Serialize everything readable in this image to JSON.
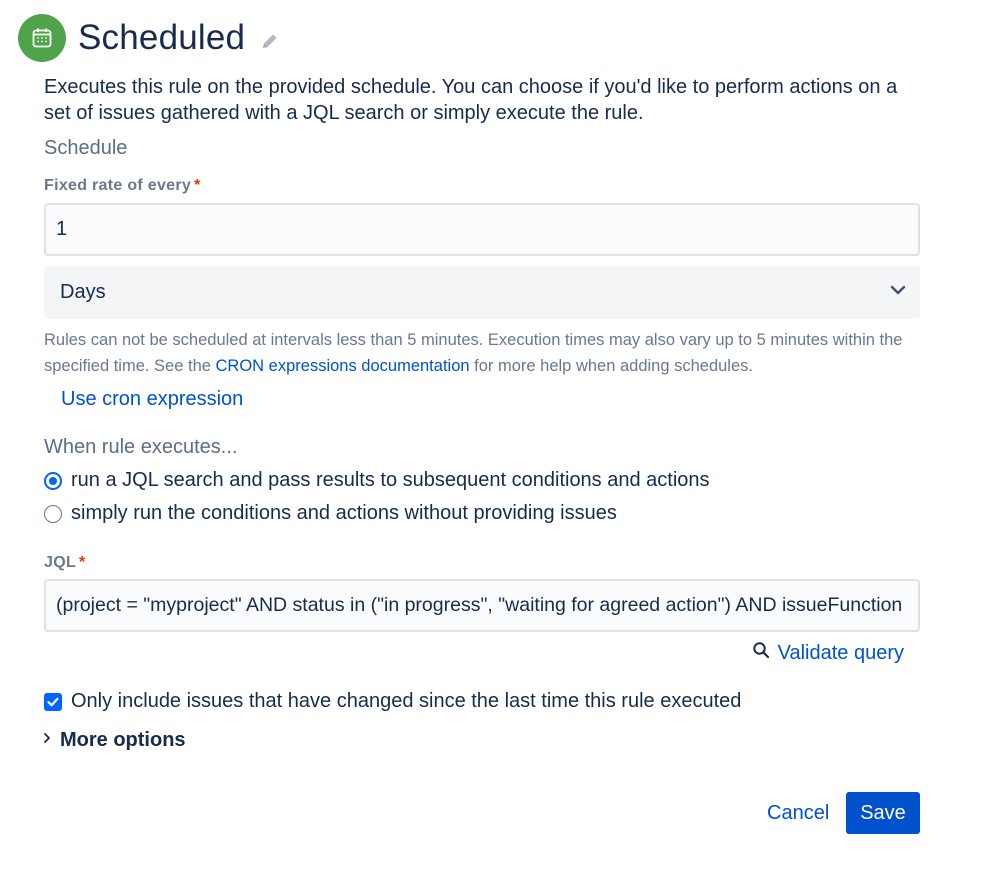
{
  "header": {
    "icon": "calendar-icon",
    "title": "Scheduled",
    "edit_icon": "pencil-icon",
    "accent_color": "#4fa34a"
  },
  "description": "Executes this rule on the provided schedule. You can choose if you'd like to perform actions on a set of issues gathered with a JQL search or simply execute the rule.",
  "schedule": {
    "section_label": "Schedule",
    "fixed_rate_label": "Fixed rate of every",
    "required_marker": "*",
    "fixed_rate_value": "1",
    "unit_selected": "Days",
    "help_before_link": "Rules can not be scheduled at intervals less than 5 minutes. Execution times may also vary up to 5 minutes within the specified time. See the ",
    "help_link": "CRON expressions documentation",
    "help_after_link": " for more help when adding schedules.",
    "cron_link": "Use cron expression"
  },
  "execution": {
    "label": "When rule executes...",
    "options": [
      {
        "label": "run a JQL search and pass results to subsequent conditions and actions",
        "selected": true
      },
      {
        "label": "simply run the conditions and actions without providing issues",
        "selected": false
      }
    ]
  },
  "jql": {
    "label": "JQL",
    "required_marker": "*",
    "value": "(project = \"myproject\" AND status in (\"in progress\", \"waiting for agreed action\") AND issueFunction",
    "validate_label": "Validate query"
  },
  "only_changed": {
    "label": "Only include issues that have changed since the last time this rule executed",
    "checked": true
  },
  "more_options_label": "More options",
  "buttons": {
    "cancel": "Cancel",
    "save": "Save"
  }
}
